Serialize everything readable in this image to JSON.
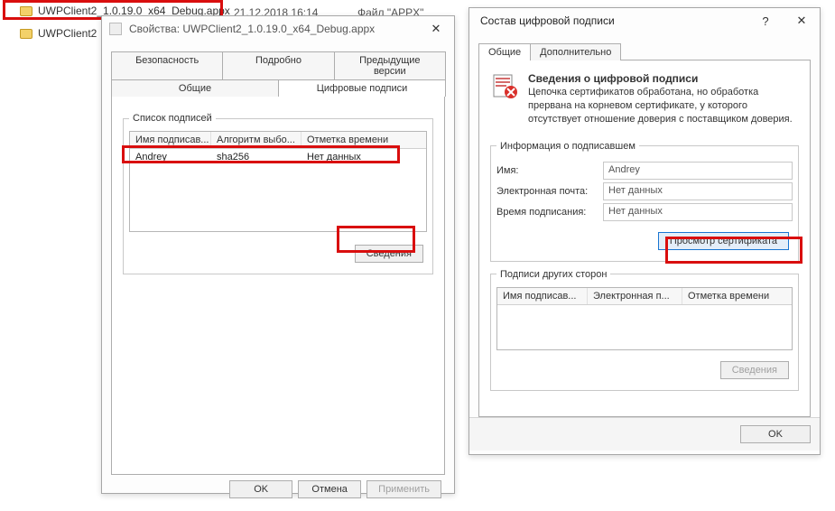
{
  "explorer": {
    "file1": "UWPClient2_1.0.19.0_x64_Debug.appx",
    "file2": "UWPClient2",
    "date": "21.12.2018 16:14",
    "type": "Файл \"APPX\""
  },
  "props": {
    "title": "Свойства: UWPClient2_1.0.19.0_x64_Debug.appx",
    "tabs": {
      "security": "Безопасность",
      "details": "Подробно",
      "prev_versions": "Предыдущие версии",
      "general": "Общие",
      "signatures": "Цифровые подписи"
    },
    "group_signatures": "Список подписей",
    "headers": {
      "signer": "Имя подписав...",
      "algo": "Алгоритм выбо...",
      "timestamp": "Отметка времени"
    },
    "row": {
      "signer": "Andrey",
      "algo": "sha256",
      "timestamp": "Нет данных"
    },
    "btn_details": "Сведения",
    "btn_ok": "OK",
    "btn_cancel": "Отмена",
    "btn_apply": "Применить"
  },
  "sig": {
    "title": "Состав цифровой подписи",
    "tabs": {
      "general": "Общие",
      "advanced": "Дополнительно"
    },
    "header_title": "Сведения о цифровой подписи",
    "header_text": "Цепочка сертификатов обработана, но обработка прервана на корневом сертификате, у которого отсутствует отношение доверия с поставщиком доверия.",
    "group_signer": "Информация о подписавшем",
    "label_name": "Имя:",
    "label_email": "Электронная почта:",
    "label_time": "Время подписания:",
    "val_name": "Andrey",
    "val_email": "Нет данных",
    "val_time": "Нет данных",
    "btn_view_cert": "Просмотр сертификата",
    "group_counter": "Подписи других сторон",
    "headers": {
      "signer": "Имя подписав...",
      "email": "Электронная п...",
      "timestamp": "Отметка времени"
    },
    "btn_details": "Сведения",
    "btn_ok": "OK"
  }
}
